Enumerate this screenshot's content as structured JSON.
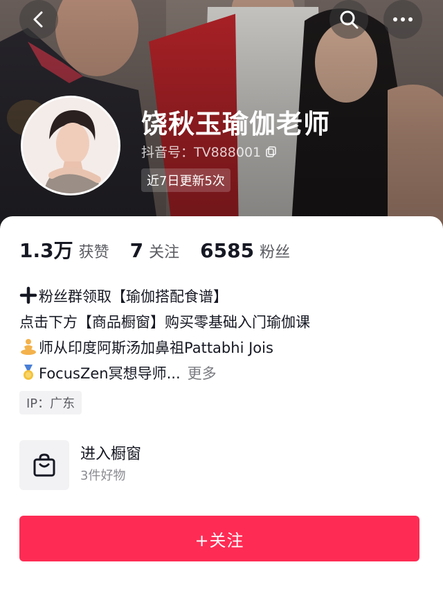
{
  "profile": {
    "nickname": "饶秋玉瑜伽老师",
    "douyin_id": "抖音号：TV888001",
    "update_badge": "近7日更新5次"
  },
  "icons": {
    "back": "chevron-left-icon",
    "search": "search-icon",
    "more": "more-dots-icon",
    "copy": "copy-icon",
    "shop": "shopping-bag-icon"
  },
  "stats": [
    {
      "value": "1.3万",
      "label": "获赞"
    },
    {
      "value": "7",
      "label": "关注"
    },
    {
      "value": "6585",
      "label": "粉丝"
    }
  ],
  "bio": {
    "line1": "粉丝群领取【瑜伽搭配食谱】",
    "line2": "点击下方【商品橱窗】购买零基础入门瑜伽课",
    "line3": "师从印度阿斯汤加鼻祖Pattabhi Jois",
    "line4": "FocusZen冥想导师...",
    "more": "更多"
  },
  "ip": "IP：广东",
  "shop": {
    "title": "进入橱窗",
    "subtitle": "3件好物"
  },
  "follow_button": "+关注",
  "colors": {
    "accent": "#fe2c55",
    "text": "#161823",
    "secondary_text": "#5b5c62"
  }
}
